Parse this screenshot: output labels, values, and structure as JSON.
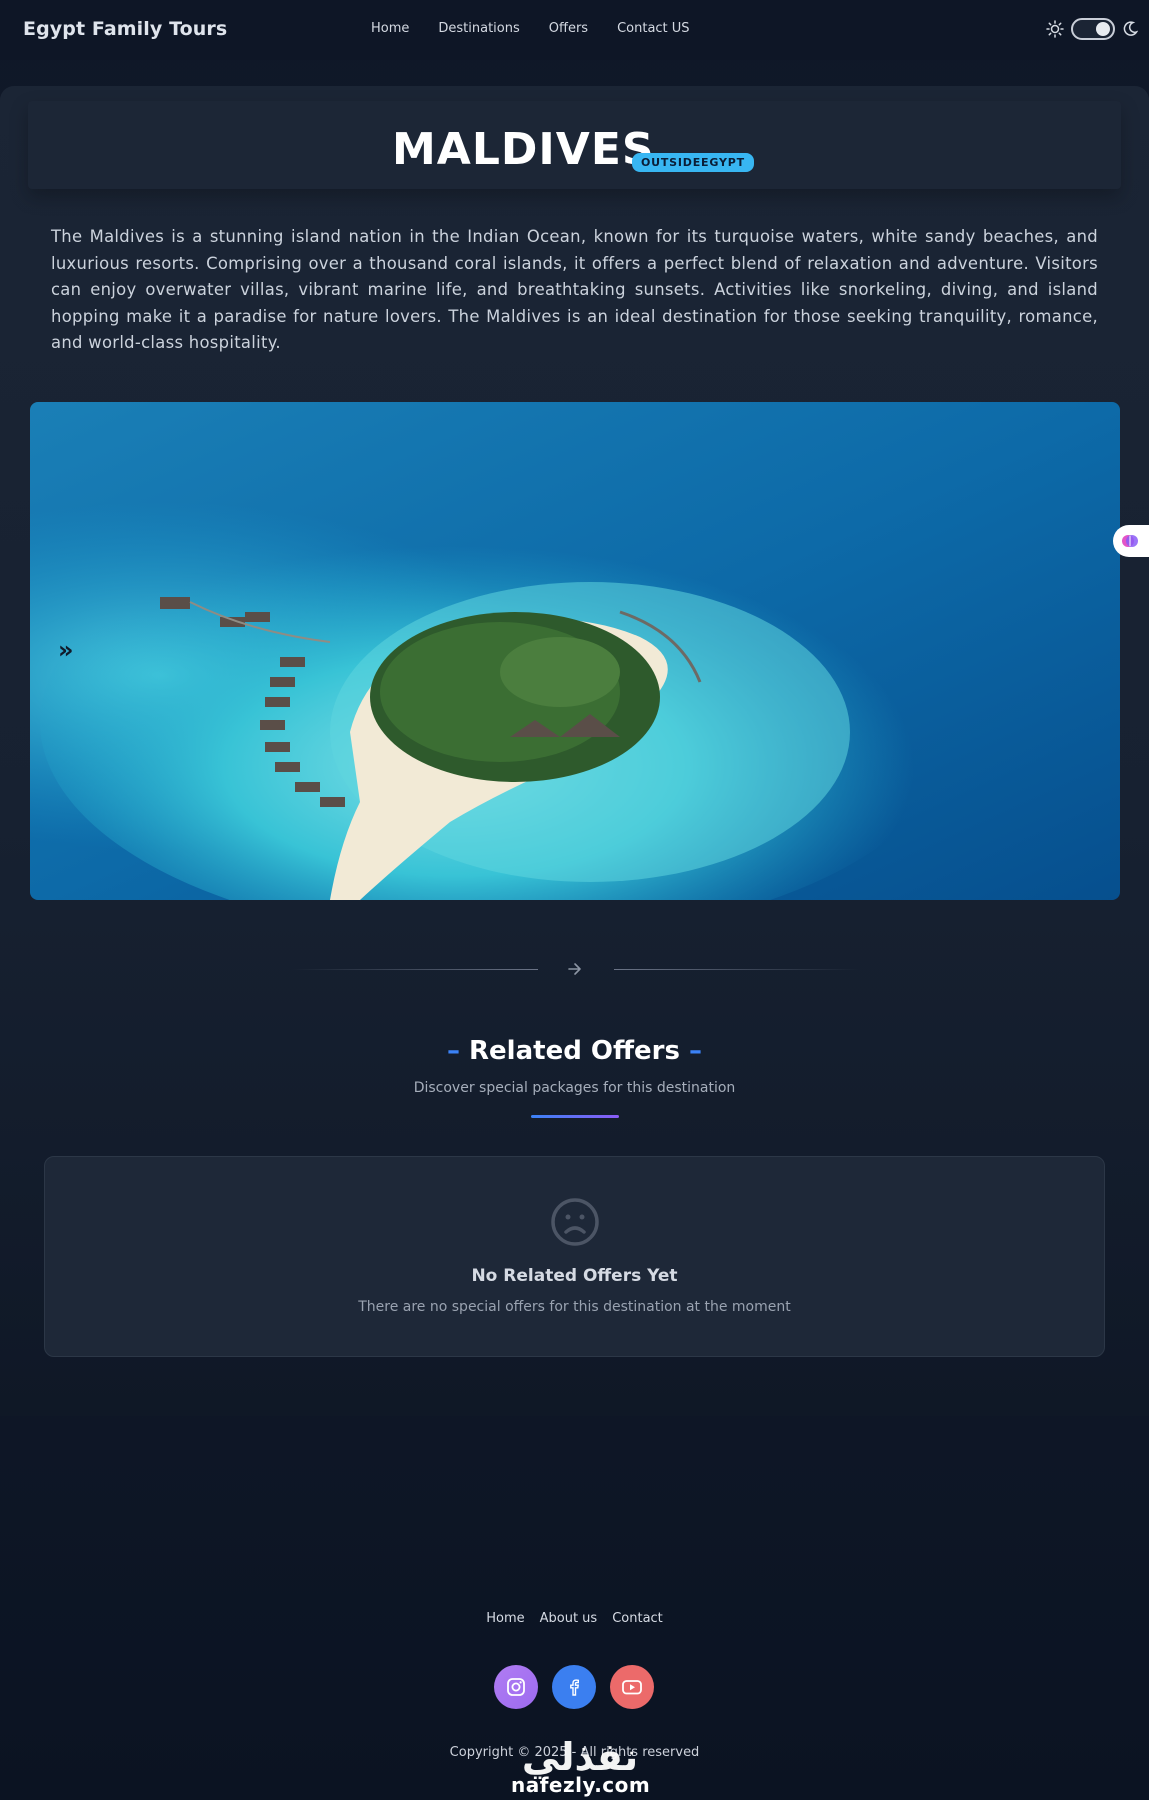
{
  "navbar": {
    "brand": "Egypt Family Tours",
    "links": [
      "Home",
      "Destinations",
      "Offers",
      "Contact US"
    ],
    "theme_toggle": "on"
  },
  "destination": {
    "title": "MALDIVES",
    "badge": "OUTSIDEEGYPT",
    "description": "The Maldives is a stunning island nation in the Indian Ocean, known for its turquoise waters, white sandy beaches, and luxurious resorts. Comprising over a thousand coral islands, it offers a perfect blend of relaxation and adventure. Visitors can enjoy overwater villas, vibrant marine life, and breathtaking sunsets. Activities like snorkeling, diving, and island hopping make it a paradise for nature lovers. The Maldives is an ideal destination for those seeking tranquility, romance, and world-class hospitality."
  },
  "carousel": {
    "next_label": "»"
  },
  "related_offers": {
    "title": "Related Offers",
    "subtitle": "Discover special packages for this destination",
    "empty_title": "No Related Offers Yet",
    "empty_text": "There are no special offers for this destination at the moment"
  },
  "footer": {
    "links": [
      "Home",
      "About us",
      "Contact"
    ],
    "copyright": "Copyright © 2025 - All rights reserved",
    "socials": [
      "instagram-icon",
      "facebook-icon",
      "youtube-icon"
    ]
  },
  "watermark": {
    "logo_text": "نفذلي",
    "site": "nafezly.com"
  },
  "colors": {
    "accent_blue": "#3b82f6",
    "accent_purple": "#8b5cf6",
    "badge_bg": "#38b6f2",
    "instagram": "#a673f1",
    "facebook": "#3b7ff0",
    "youtube": "#ec6a6a"
  }
}
